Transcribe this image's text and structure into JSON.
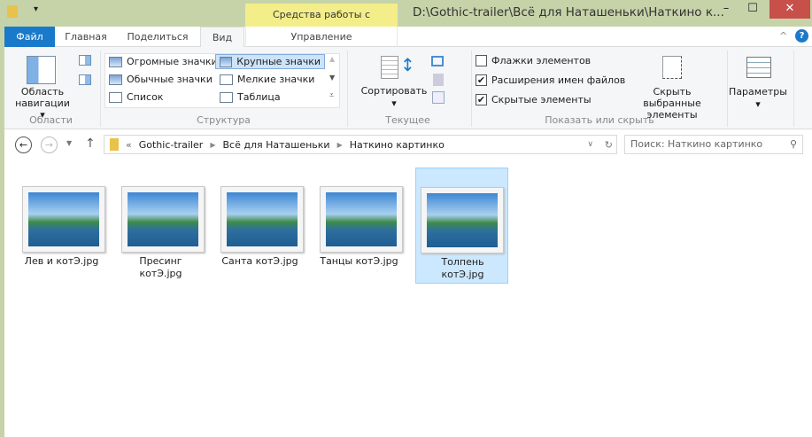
{
  "titlebar": {
    "context_tab": "Средства работы с рисунками",
    "title": "D:\\Gothic-trailer\\Всё для Наташеньки\\Наткино к...",
    "minimize": "–",
    "maximize": "☐",
    "close": "✕"
  },
  "tabs": [
    {
      "label": "Файл",
      "active": false
    },
    {
      "label": "Главная"
    },
    {
      "label": "Поделиться"
    },
    {
      "label": "Вид",
      "active": true
    },
    {
      "label": "Управление"
    }
  ],
  "ribbon": {
    "areas": {
      "nav_pane": "Область навигации",
      "label": "Области"
    },
    "layout": {
      "items": [
        "Огромные значки",
        "Крупные значки",
        "Обычные значки",
        "Мелкие значки",
        "Список",
        "Таблица"
      ],
      "selected": "Крупные значки",
      "label": "Структура"
    },
    "current_view": {
      "sort": "Сортировать",
      "label": "Текущее представление"
    },
    "show_hide": {
      "checkboxes": [
        {
          "label": "Флажки элементов",
          "checked": false
        },
        {
          "label": "Расширения имен файлов",
          "checked": true
        },
        {
          "label": "Скрытые элементы",
          "checked": true
        }
      ],
      "hide_selected": "Скрыть выбранные элементы",
      "label": "Показать или скрыть"
    },
    "options": "Параметры"
  },
  "address": {
    "breadcrumb": [
      "Gothic-trailer",
      "Всё для Наташеньки",
      "Наткино картинко"
    ],
    "search_placeholder": "Поиск: Наткино картинко"
  },
  "files": [
    {
      "name": "Лев и  котЭ.jpg"
    },
    {
      "name": "Пресинг котЭ.jpg"
    },
    {
      "name": "Санта котЭ.jpg"
    },
    {
      "name": "Танцы котЭ.jpg"
    },
    {
      "name": "Толпень котЭ.jpg",
      "selected": true
    }
  ],
  "colors": {
    "frame": "#c6d3a8",
    "file_tab": "#1979ca",
    "selection": "#cce8ff",
    "context_tab": "#f3ee8a"
  }
}
